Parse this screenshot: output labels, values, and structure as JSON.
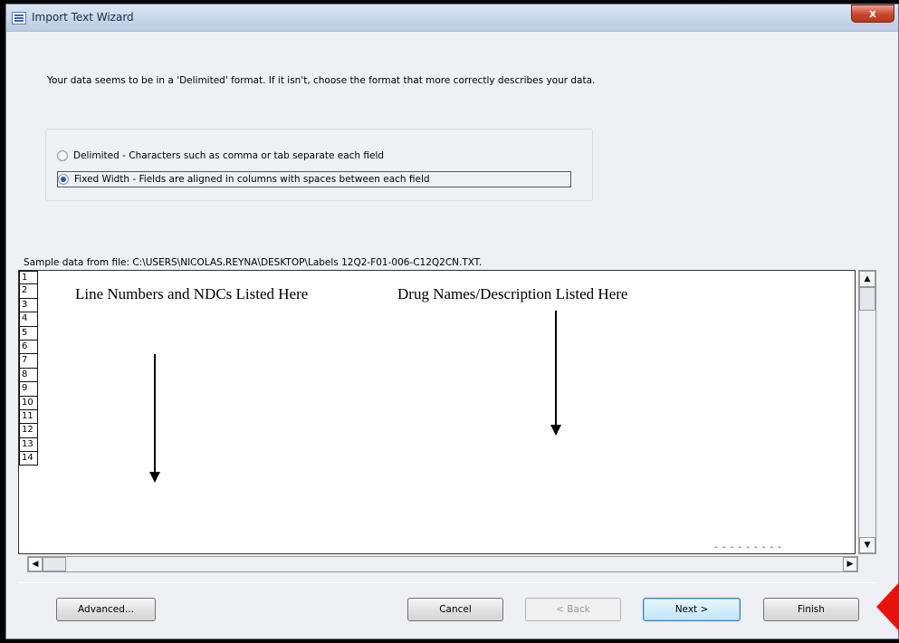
{
  "window": {
    "title": "Import Text Wizard",
    "close_glyph": "x"
  },
  "description": "Your data seems to be in a 'Delimited' format. If it isn't, choose the format that more correctly describes your data.",
  "format_options": {
    "delimited_label": "Delimited - Characters such as comma or tab separate each field",
    "fixed_width_label": "Fixed Width - Fields are aligned in columns with spaces between each field",
    "selected": "Fixed Width"
  },
  "sample": {
    "label": "Sample data from file: C:\\USERS\\NICOLAS.REYNA\\DESKTOP\\Labels 12Q2-F01-006-C12Q2CN.TXT.",
    "line_numbers": [
      "1",
      "2",
      "3",
      "4",
      "5",
      "6",
      "7",
      "8",
      "9",
      "10",
      "11",
      "12",
      "13",
      "14"
    ],
    "annotation_left": "Line Numbers and NDCs Listed Here",
    "annotation_right": "Drug Names/Description Listed Here",
    "trailing_dashes": "- - - - - - - - -"
  },
  "buttons": {
    "advanced": "Advanced...",
    "cancel": "Cancel",
    "back": "< Back",
    "next": "Next >",
    "finish": "Finish"
  },
  "colors": {
    "marker_red": "#e8120c",
    "selection_blue": "#2b58b5"
  }
}
